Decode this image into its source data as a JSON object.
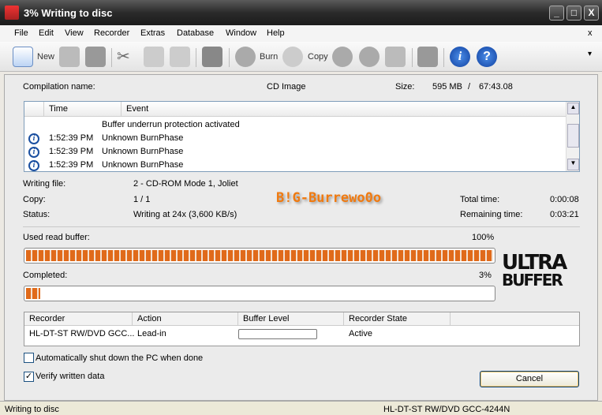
{
  "window": {
    "title": "3% Writing to disc",
    "minimize": "_",
    "maximize": "□",
    "close": "X"
  },
  "menu": [
    "File",
    "Edit",
    "View",
    "Recorder",
    "Extras",
    "Database",
    "Window",
    "Help"
  ],
  "menu_close": "x",
  "toolbar": {
    "new": "New",
    "burn": "Burn",
    "copy": "Copy"
  },
  "compilation": {
    "label": "Compilation name:",
    "value": "CD Image",
    "size_label": "Size:",
    "size": "595 MB",
    "sep": "/",
    "duration": "67:43.08"
  },
  "log": {
    "columns": [
      "Time",
      "Event"
    ],
    "rows": [
      {
        "icon": "",
        "time": "",
        "event": "Buffer underrun protection activated"
      },
      {
        "icon": "info-icon",
        "time": "1:52:39 PM",
        "event": "Unknown BurnPhase"
      },
      {
        "icon": "info-icon",
        "time": "1:52:39 PM",
        "event": "Unknown BurnPhase"
      },
      {
        "icon": "info-icon",
        "time": "1:52:39 PM",
        "event": "Unknown BurnPhase"
      }
    ]
  },
  "info": {
    "writing_file_label": "Writing file:",
    "writing_file": "2 - CD-ROM Mode 1, Joliet",
    "copy_label": "Copy:",
    "copy": "1 / 1",
    "status_label": "Status:",
    "status": "Writing at 24x (3,600 KB/s)",
    "total_label": "Total time:",
    "total": "0:00:08",
    "remaining_label": "Remaining time:",
    "remaining": "0:03:21"
  },
  "watermark": "B!G-Burrewo0o",
  "buffer": {
    "label": "Used read buffer:",
    "percent_text": "100%",
    "value": 100
  },
  "completed": {
    "label": "Completed:",
    "percent_text": "3%",
    "value": 3
  },
  "logo": [
    "ULTRA",
    "BUFFER"
  ],
  "recorder": {
    "columns": [
      "Recorder",
      "Action",
      "Buffer Level",
      "Recorder State"
    ],
    "row": {
      "recorder": "HL-DT-ST RW/DVD GCC...",
      "action": "Lead-in",
      "buffer_level": 0,
      "state": "Active"
    }
  },
  "options": {
    "shutdown": {
      "label": "Automatically shut down the PC when done",
      "checked": false
    },
    "verify": {
      "label": "Verify written data",
      "checked": true
    }
  },
  "cancel": "Cancel",
  "statusbar": {
    "left": "Writing to disc",
    "right": "HL-DT-ST RW/DVD GCC-4244N"
  },
  "colors": {
    "accent": "#e06a1a",
    "titlebar": "#2a2a2a"
  }
}
